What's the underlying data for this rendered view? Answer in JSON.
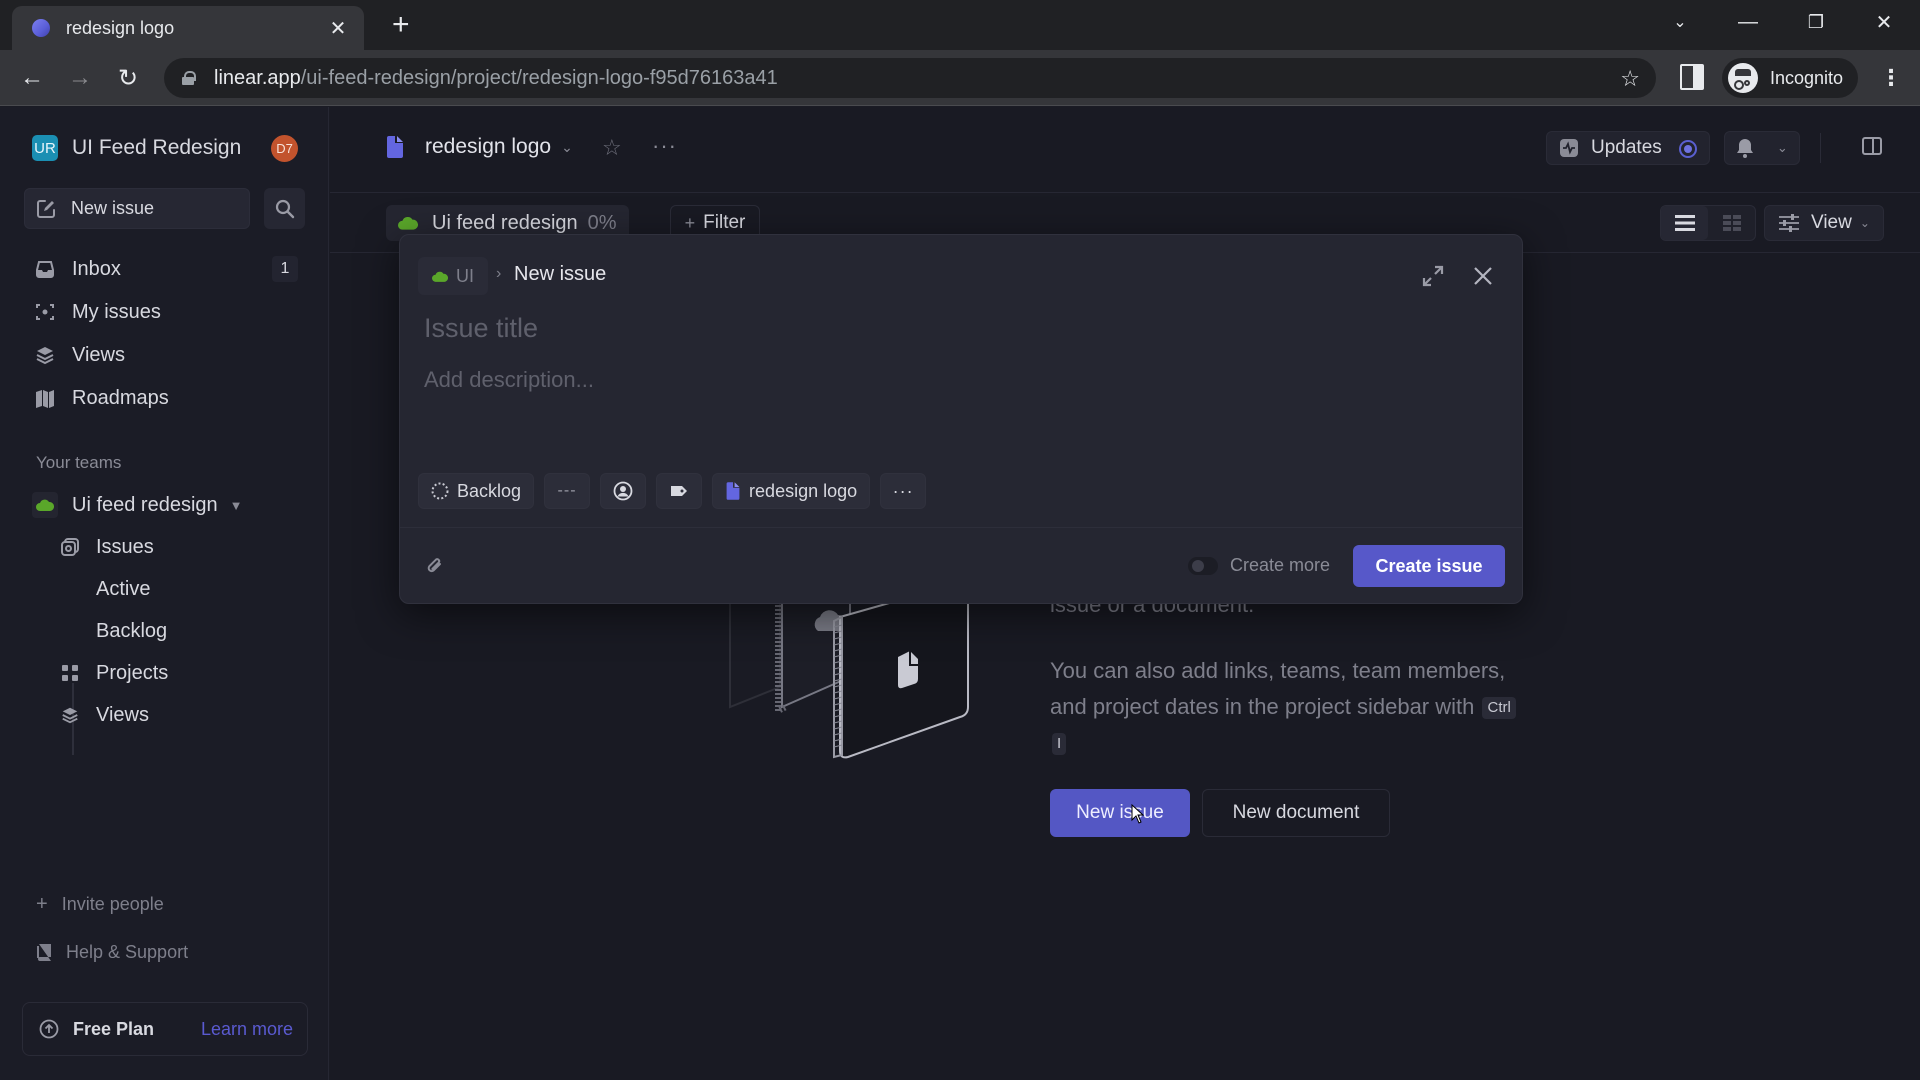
{
  "browser": {
    "tab_title": "redesign logo",
    "url_host": "linear.app",
    "url_path": "/ui-feed-redesign/project/redesign-logo-f95d76163a41",
    "profile_label": "Incognito"
  },
  "sidebar": {
    "workspace_initials": "UR",
    "workspace_name": "UI Feed Redesign",
    "user_initials": "D7",
    "new_issue_label": "New issue",
    "items": [
      {
        "label": "Inbox",
        "icon": "inbox-icon",
        "count": "1"
      },
      {
        "label": "My issues",
        "icon": "my-issues-icon"
      },
      {
        "label": "Views",
        "icon": "views-icon"
      },
      {
        "label": "Roadmaps",
        "icon": "roadmap-icon"
      }
    ],
    "teams_heading": "Your teams",
    "team": {
      "name": "Ui feed redesign",
      "items": [
        {
          "label": "Issues"
        },
        {
          "label": "Active"
        },
        {
          "label": "Backlog"
        },
        {
          "label": "Projects"
        },
        {
          "label": "Views"
        }
      ]
    },
    "invite_label": "Invite people",
    "help_label": "Help & Support",
    "plan_label": "Free Plan",
    "learn_more_label": "Learn more"
  },
  "header": {
    "project_title": "redesign logo",
    "updates_label": "Updates",
    "team_chip_label": "Ui feed redesign",
    "team_chip_progress": "0%",
    "filter_label": "Filter",
    "view_label": "View"
  },
  "empty_state": {
    "paragraph1": "issue or a document.",
    "paragraph2": "You can also add links, teams, team members, and project dates in the project sidebar with",
    "shortcut_keys": [
      "Ctrl",
      "I"
    ],
    "new_issue_label": "New issue",
    "new_document_label": "New document"
  },
  "modal": {
    "team_crumb": "UI",
    "crumb_title": "New issue",
    "title_placeholder": "Issue title",
    "title_value": "",
    "description_placeholder": "Add description...",
    "description_value": "",
    "status_label": "Backlog",
    "priority_label": "---",
    "project_label": "redesign logo",
    "create_more_label": "Create more",
    "create_more_enabled": false,
    "create_button_label": "Create issue"
  },
  "colors": {
    "accent": "#5758c9",
    "team_green": "#5aa72a",
    "workspace_teal": "#1b8fb3",
    "avatar_orange": "#c2532d",
    "project_icon": "#6366e0"
  }
}
